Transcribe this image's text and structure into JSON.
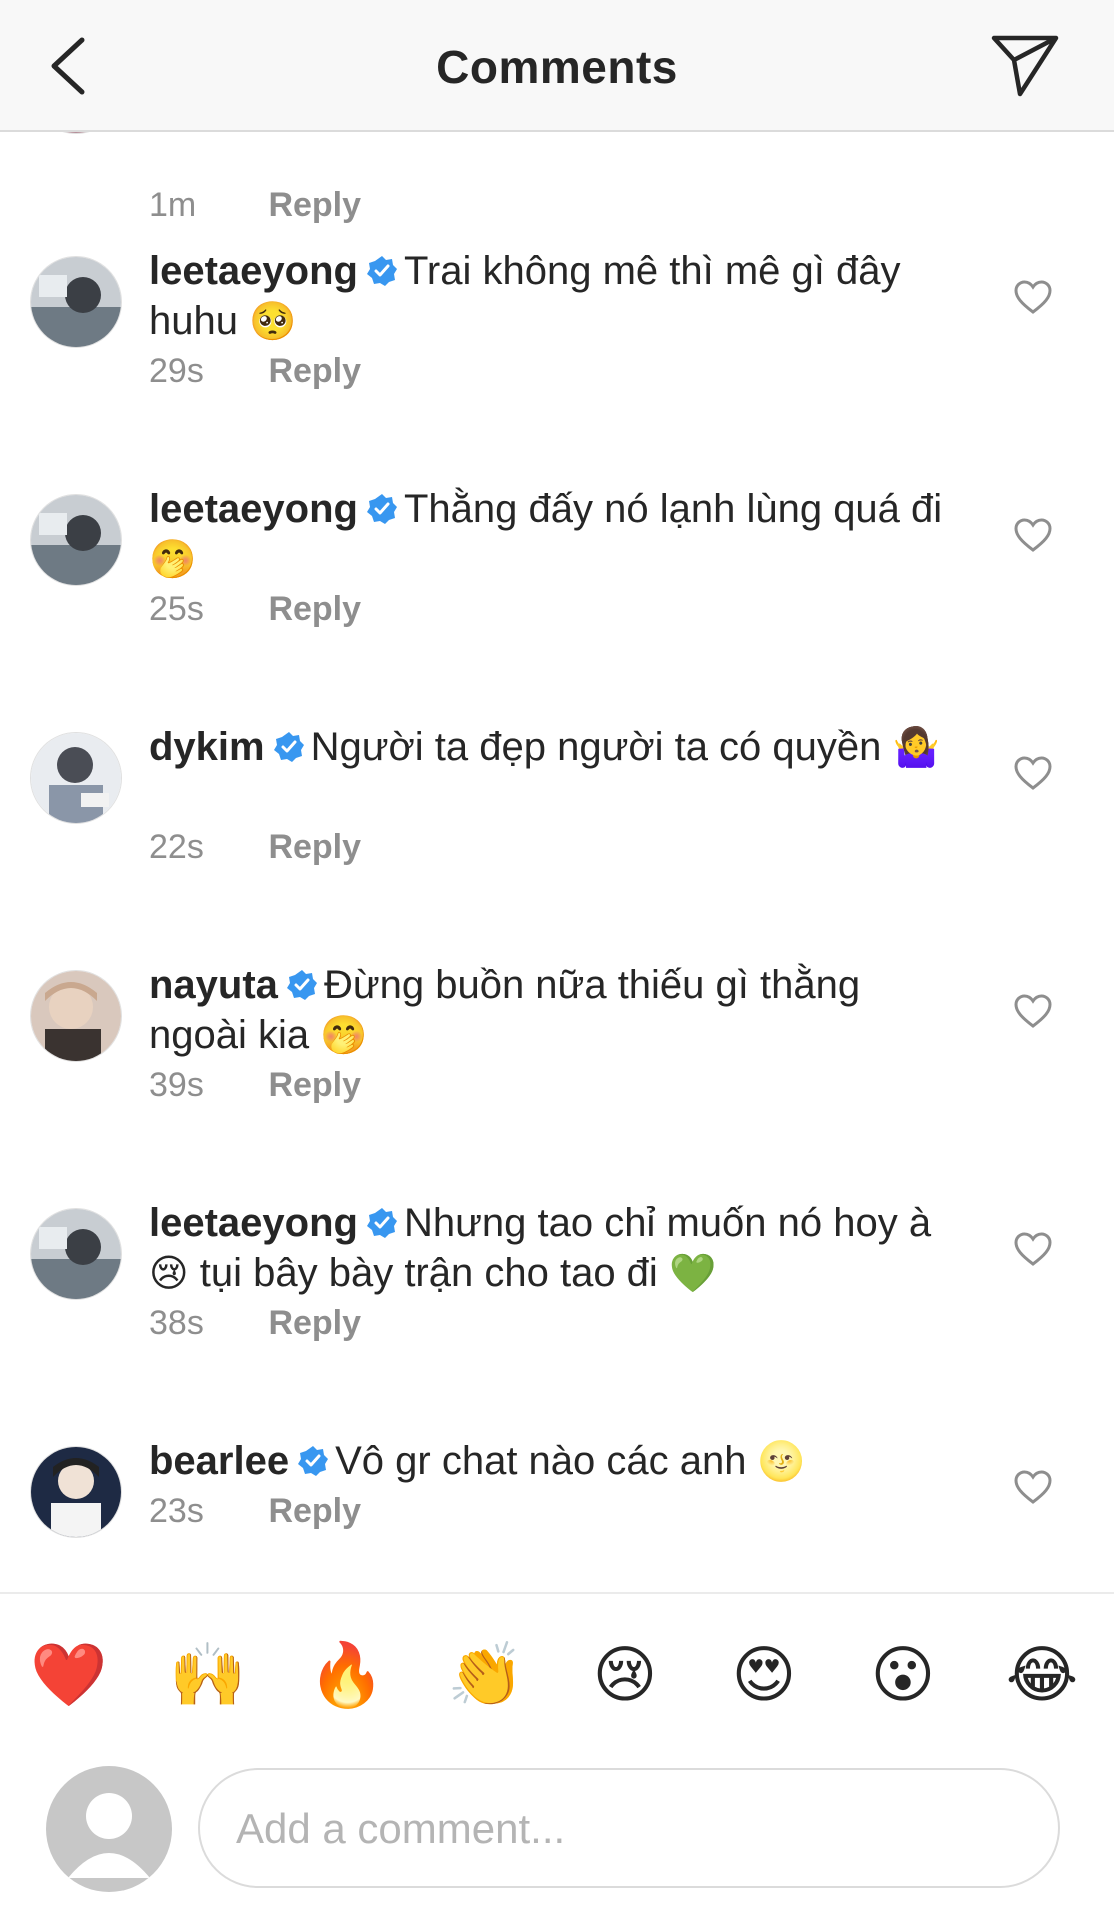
{
  "header": {
    "title": "Comments",
    "back_icon": "chevron-left-icon",
    "send_icon": "paper-plane-icon"
  },
  "comments": [
    {
      "time": "1m",
      "reply_label": "Reply"
    },
    {
      "username": "leetaeyong",
      "verified": true,
      "text": "Trai không mê thì mê gì đây huhu",
      "emoji": "🥺",
      "time": "29s",
      "reply_label": "Reply"
    },
    {
      "username": "leetaeyong",
      "verified": true,
      "text": "Thằng đấy nó lạnh lùng quá đi",
      "emoji": "🤭",
      "time": "25s",
      "reply_label": "Reply"
    },
    {
      "username": "dykim",
      "verified": true,
      "text": "Người ta đẹp người ta có quyền",
      "emoji": "🤷‍♀️",
      "time": "22s",
      "reply_label": "Reply"
    },
    {
      "username": "nayuta",
      "verified": true,
      "text": "Đừng buồn nữa thiếu gì thằng ngoài kia",
      "emoji": "🤭",
      "time": "39s",
      "reply_label": "Reply"
    },
    {
      "username": "leetaeyong",
      "verified": true,
      "text_part1": "Nhưng tao chỉ muốn nó hoy à",
      "emoji1": "😢",
      "text_part2": "tụi bây bày trận cho tao đi",
      "emoji2": "💚",
      "time": "38s",
      "reply_label": "Reply"
    },
    {
      "username": "bearlee",
      "verified": true,
      "text": "Vô gr chat nào các anh",
      "emoji": "🌝",
      "time": "23s",
      "reply_label": "Reply"
    }
  ],
  "reactions": [
    "❤️",
    "🙌",
    "🔥",
    "👏",
    "😢",
    "😍",
    "😮",
    "😂"
  ],
  "composer": {
    "placeholder": "Add a comment..."
  },
  "colors": {
    "verified_blue": "#3897f0",
    "meta_gray": "#8e8e8e",
    "text": "#262626"
  }
}
